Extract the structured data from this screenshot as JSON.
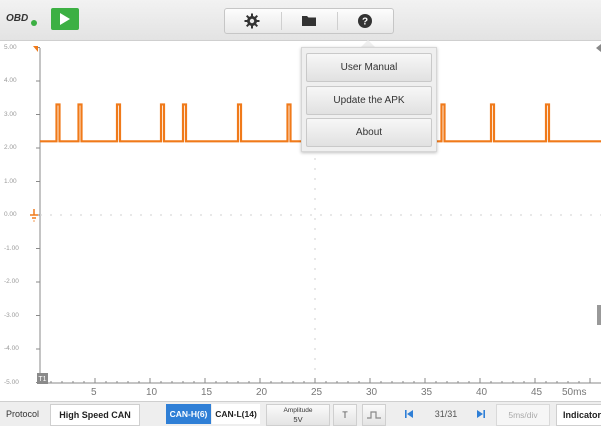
{
  "topbar": {
    "obd_label": "OBD",
    "icons": [
      "play-icon",
      "gear-icon",
      "folder-icon",
      "help-icon"
    ]
  },
  "help_menu": {
    "items": [
      "User Manual",
      "Update the APK",
      "About"
    ]
  },
  "plot": {
    "y_ticks": [
      "5.00",
      "4.00",
      "3.00",
      "2.00",
      "1.00",
      "0.00",
      "-1.00",
      "-2.00",
      "-3.00",
      "-4.00",
      "-5.00"
    ],
    "x_ticks": [
      "5",
      "10",
      "15",
      "20",
      "25",
      "30",
      "35",
      "40",
      "45",
      "50ms"
    ],
    "trace_color": "#f07a1a",
    "baseline_value": 2.2,
    "pulse_value": 3.3,
    "pulse_positions_ms": [
      1.5,
      3.5,
      7.0,
      11.0,
      13.0,
      18.0,
      22.5,
      26.0,
      30.0,
      36.5,
      41.0,
      46.0
    ],
    "cursor_marker": "T1"
  },
  "bottombar": {
    "protocol_label": "Protocol",
    "protocol_value": "High Speed CAN",
    "can_h": "CAN-H(6)",
    "can_l": "CAN-L(14)",
    "amplitude_label": "Amplitude",
    "amplitude_value": "5V",
    "trigger_label": "T",
    "page": "31/31",
    "timebase": "5ms/div",
    "indicator": "Indicator"
  },
  "colors": {
    "accent_blue": "#2f7fd6",
    "play_green": "#3cb043",
    "trace_orange": "#f07a1a"
  }
}
